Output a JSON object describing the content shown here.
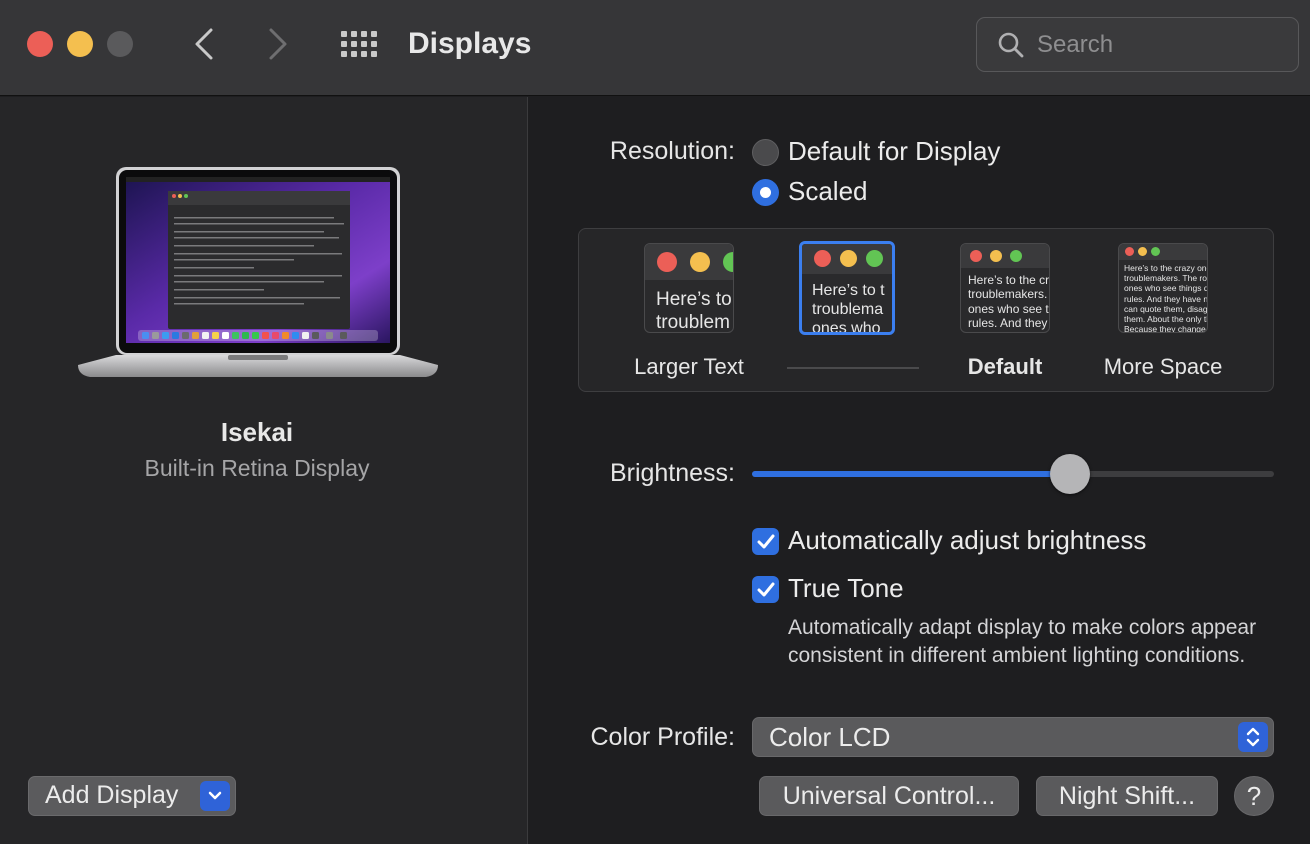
{
  "window": {
    "title": "Displays",
    "search_placeholder": "Search"
  },
  "left": {
    "display_name": "Isekai",
    "display_subtitle": "Built-in Retina Display",
    "add_display_label": "Add Display"
  },
  "right": {
    "resolution_label": "Resolution:",
    "resolution_options": [
      {
        "label": "Default for Display",
        "selected": false
      },
      {
        "label": "Scaled",
        "selected": true
      }
    ],
    "scale_options": [
      {
        "label": "Larger Text",
        "preview": "Here’s to t\ntroublem",
        "selected": false
      },
      {
        "label": "",
        "preview": "Here’s to t\ntroublema\nones who",
        "selected": true
      },
      {
        "label": "Default",
        "preview": "Here’s to the cr\ntroublemakers.\nones who see t\nrules. And they",
        "selected": false
      },
      {
        "label": "More Space",
        "preview": "Here’s to the crazy ones\ntroublemakers. The rou\nones who see things dif\nrules. And they have no\ncan quote them, disagre\nthem. About the only th\nBecause they change th",
        "selected": false
      }
    ],
    "brightness_label": "Brightness:",
    "brightness_value": 0.61,
    "auto_brightness_label": "Automatically adjust brightness",
    "auto_brightness_checked": true,
    "true_tone_label": "True Tone",
    "true_tone_checked": true,
    "true_tone_description": "Automatically adapt display to make colors appear consistent in different ambient lighting conditions.",
    "color_profile_label": "Color Profile:",
    "color_profile_value": "Color LCD",
    "universal_control_label": "Universal Control...",
    "night_shift_label": "Night Shift...",
    "help_label": "?"
  },
  "colors": {
    "accent": "#2f6fe0",
    "close": "#ec5f57",
    "minimize": "#f4bf4f",
    "zoom_disabled": "#5a5a5c"
  }
}
